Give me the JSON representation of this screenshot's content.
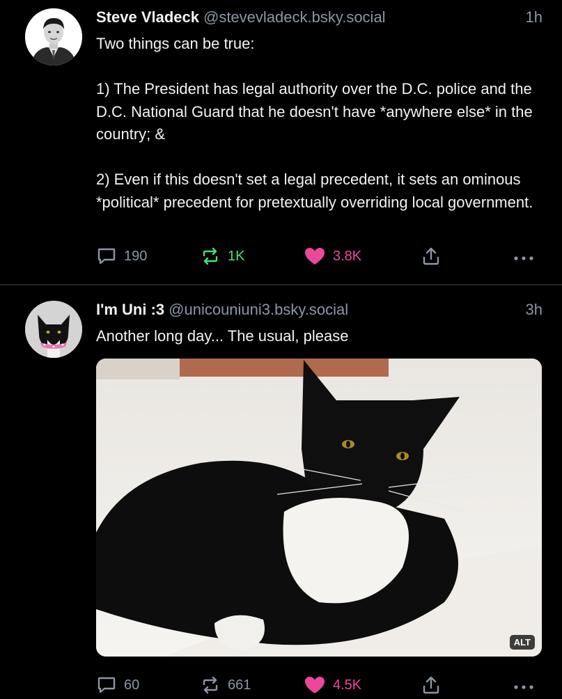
{
  "posts": [
    {
      "author_name": "Steve Vladeck",
      "handle": "@stevevladeck.bsky.social",
      "time": "1h",
      "text": "Two things can be true:\n\n1) The President has legal authority over the D.C. police and the D.C. National Guard that he doesn't have *anywhere else* in the country; &\n\n2) Even if this doesn't set a legal precedent, it sets an ominous *political* precedent for pretextually overriding local government.",
      "replies": "190",
      "reposts": "1K",
      "likes": "3.8K",
      "reposted": true,
      "liked": true
    },
    {
      "author_name": "I'm Uni :3",
      "handle": "@unicouniuni3.bsky.social",
      "time": "3h",
      "text": "Another long day... The usual, please",
      "alt_badge": "ALT",
      "replies": "60",
      "reposts": "661",
      "likes": "4.5K",
      "reposted": false,
      "liked": true
    }
  ],
  "colors": {
    "background": "#000000",
    "text": "#f1f3f5",
    "muted": "#8c96a4",
    "repost_active": "#4ade80",
    "like": "#ec4899"
  }
}
